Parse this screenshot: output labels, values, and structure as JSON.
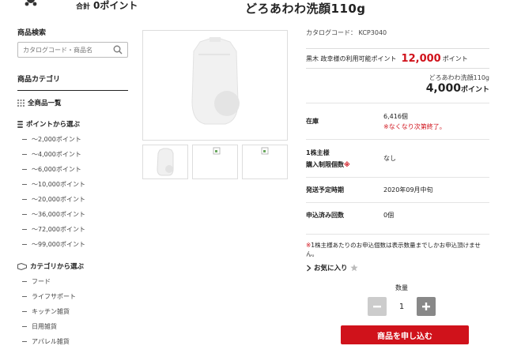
{
  "header": {
    "total_label": "合計",
    "total_value": "0ポイント",
    "cart_icon": "cart-icon"
  },
  "sidebar": {
    "search_heading": "商品検索",
    "search_placeholder": "カタログコード・商品名",
    "category_heading": "商品カテゴリ",
    "all_items": "全商品一覧",
    "points_heading": "ポイントから選ぶ",
    "point_ranges": [
      "～2,000ポイント",
      "～4,000ポイント",
      "～6,000ポイント",
      "～10,000ポイント",
      "～20,000ポイント",
      "～36,000ポイント",
      "～72,000ポイント",
      "～99,000ポイント"
    ],
    "category_select_heading": "カテゴリから選ぶ",
    "categories": [
      "フード",
      "ライフサポート",
      "キッチン雑貨",
      "日用雑貨",
      "アパレル雑貨"
    ]
  },
  "product": {
    "title": "どろあわわ洗顔110g",
    "catalog_code": "カタログコード： KCP3040",
    "available_prefix": "黒木 政幸様の利用可能ポイント",
    "available_points": "12,000",
    "available_suffix": "ポイント",
    "price_name": "どろあわわ洗顔110g",
    "price_value": "4,000",
    "price_unit": "ポイント",
    "stock_label": "在庫",
    "stock_value": "6,416個",
    "stock_note": "※なくなり次第終了。",
    "limit_label_1": "1株主様",
    "limit_label_2": "購入制限個数",
    "limit_mark": "※",
    "limit_value": "なし",
    "ship_label": "発送予定時期",
    "ship_value": "2020年09月中旬",
    "applied_label": "申込済み回数",
    "applied_value": "0個",
    "note_mark": "※",
    "note_text": "1株主様あたりのお申込個数は表示数量までしかお申込頂けません。",
    "favorite_label": "お気に入り",
    "qty_label": "数量",
    "qty_value": "1",
    "order_label": "商品を申し込む"
  },
  "colors": {
    "accent": "#d0121b"
  }
}
